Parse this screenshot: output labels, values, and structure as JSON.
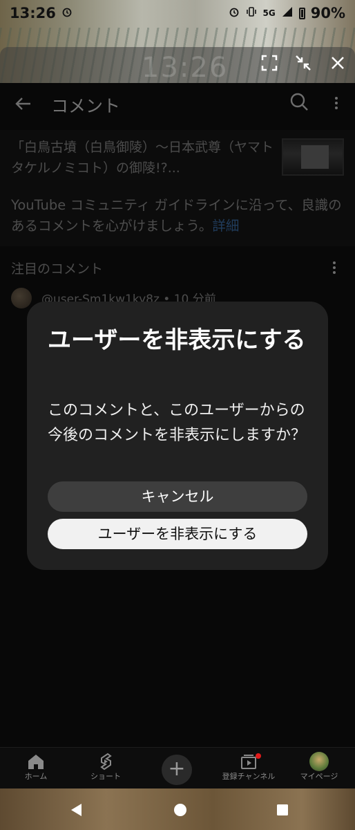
{
  "status_bar": {
    "time": "13:26",
    "network": "5G",
    "battery": "90%"
  },
  "floating_toolbar": {
    "ghost_clock": "13:26"
  },
  "header": {
    "title": "コメント"
  },
  "video": {
    "title": "「白鳥古墳（白鳥御陵）〜日本武尊（ヤマトタケルノミコト）の御陵!?..."
  },
  "guideline": {
    "text": "YouTube コミュニティ ガイドラインに沿って、良識のあるコメントを心がけましょう。",
    "link": "詳細"
  },
  "comments": {
    "section_label": "注目のコメント",
    "first_user": "@user-Sm1kw1ky8z • 10 分前"
  },
  "dialog": {
    "title": "ユーザーを非表示にする",
    "body": "このコメントと、このユーザーからの今後のコメントを非表示にしますか？",
    "cancel_label": "キャンセル",
    "confirm_label": "ユーザーを非表示にする"
  },
  "bottom_nav": {
    "home": "ホーム",
    "shorts": "ショート",
    "subscriptions": "登録チャンネル",
    "profile": "マイページ"
  },
  "colors": {
    "background": "#0f0f0f",
    "dialog": "#212121",
    "link": "#3b6ea8",
    "badge": "#e21b1b"
  }
}
